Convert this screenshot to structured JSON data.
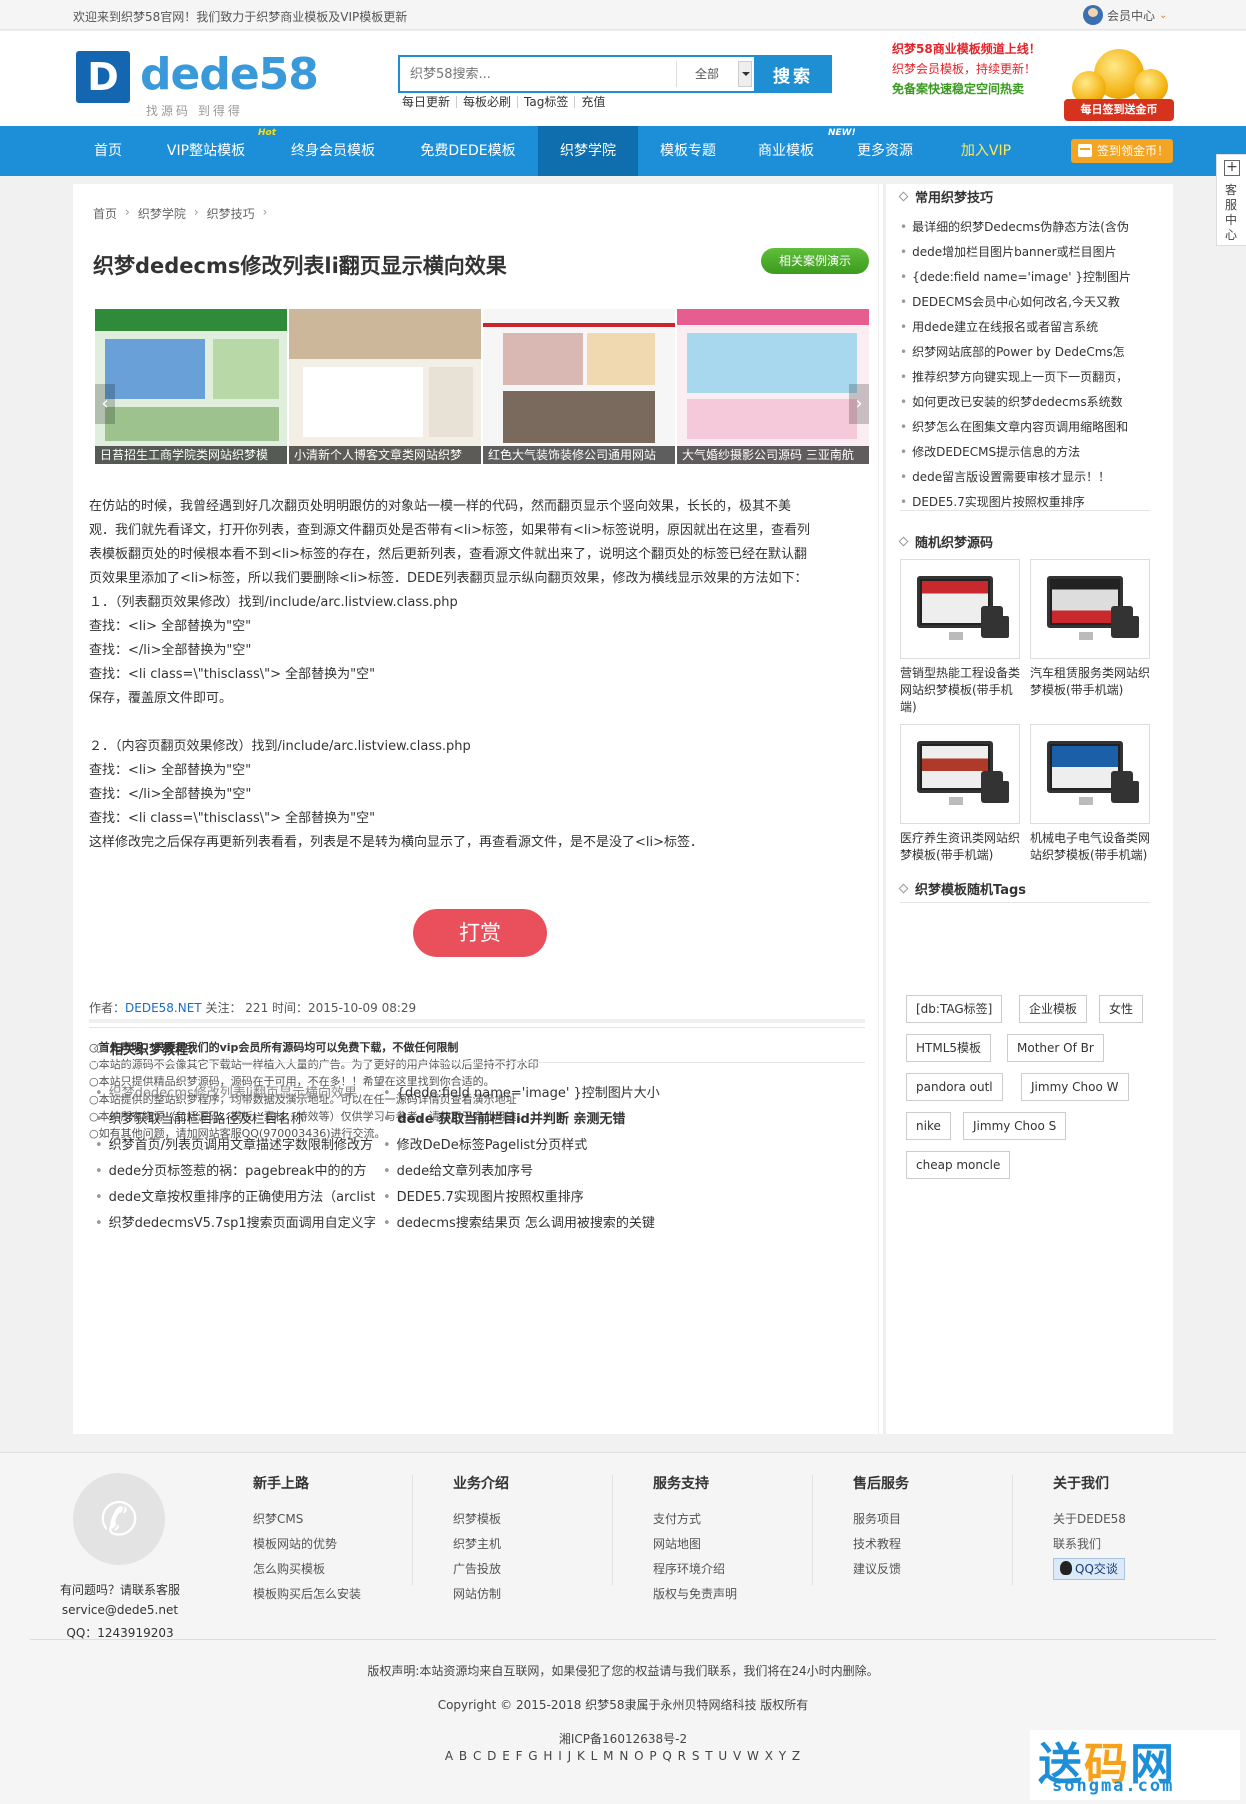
{
  "topbar": {
    "welcome": "欢迎来到织梦58官网！我们致力于织梦商业模板及VIP模板更新",
    "member_center": "会员中心"
  },
  "header": {
    "logo_text": "dede58",
    "logo_mark": "D",
    "logo_sub": "找源码 到得得",
    "search": {
      "placeholder": "织梦58搜索...",
      "scope": "全部",
      "button": "搜索"
    },
    "hotwords": [
      "每日更新",
      "每板必刷",
      "Tag标签",
      "充值"
    ],
    "promos": [
      {
        "text": "织梦58商业模板频道上线！",
        "color": "#e4242b"
      },
      {
        "text": "织梦会员模板，持续更新！",
        "color": "#e4242b"
      },
      {
        "text": "免备案快速稳定空间热卖",
        "color": "#3a9a1f"
      }
    ],
    "coin_ribbon": "每日签到送金币"
  },
  "nav": {
    "items": [
      "首页",
      "VIP整站模板",
      "终身会员模板",
      "免费DEDE模板",
      "织梦学院",
      "模板专题",
      "商业模板",
      "更多资源",
      "加入VIP"
    ],
    "badges": [
      "Hot",
      "NEW!"
    ],
    "signin": "签到领金币！"
  },
  "side_service": {
    "plus": "+",
    "label": "客服中心"
  },
  "breadcrumb": [
    "首页",
    "织梦学院",
    "织梦技巧"
  ],
  "article": {
    "title": "织梦dedecms修改列表li翻页显示横向效果",
    "demo_button": "相关案例演示",
    "slides": [
      "日苔招生工商学院类网站织梦模",
      "小清新个人博客文章类网站织梦",
      "红色大气装饰装修公司通用网站",
      "大气婚纱摄影公司源码 三亚南航"
    ],
    "paragraphs": [
      "在仿站的时候，我曾经遇到好几次翻页处明明跟仿的对象站一模一样的代码，然而翻页显示个竖向效果，长长的，极其不美",
      "观．我们就先看译文，打开你列表，查到源文件翻页处是否带有<li>标签，如果带有<li>标签说明，原因就出在这里，查看列",
      "表模板翻页处的时候根本看不到<li>标签的存在，然后更新列表，查看源文件就出来了，说明这个翻页处的标签已经在默认翻",
      "页效果里添加了<li>标签，所以我们要删除<li>标签．DEDE列表翻页显示纵向翻页效果，修改为横线显示效果的方法如下：",
      "１．（列表翻页效果修改）找到/include/arc.listview.class.php",
      "查找：<li> 全部替换为\"空\"",
      "查找：</li>全部替换为\"空\"",
      "查找：<li class=\\\"thisclass\\\"> 全部替换为\"空\"",
      "保存，覆盖原文件即可。",
      "",
      "２．（内容页翻页效果修改）找到/include/arc.listview.class.php",
      "查找：<li> 全部替换为\"空\"",
      "查找：</li>全部替换为\"空\"",
      "查找：<li class=\\\"thisclass\\\"> 全部替换为\"空\"",
      "这样修改完之后保存再更新列表看看，列表是不是转为横向显示了，再查看源文件，是不是没了<li>标签．"
    ],
    "tip_button": "打赏",
    "meta": {
      "author_label": "作者：",
      "author": "DEDE58.NET",
      "follow_label": " 关注：",
      "follow": "221",
      "time_label": " 时间：",
      "time": "2015-10-09 08:29"
    },
    "disclaimer": [
      "○首先声明，只要是我们的vip会员所有源码均可以免费下载，不做任何限制",
      "○本站的源码不会像其它下载站一样植入大量的广告。为了更好的用户体验以后坚持不打水印",
      "○本站只提供精品织梦源码，源码在于可用，不在多！！希望在这里找到你合适的。",
      "○本站提供的整站织梦程序，均带数据及演示地址。可以在任一源码详情页查看演示地址",
      "○本站所有资源（包括源码、模板、素材、特效等）仅供学习与参考，请勿用于商业用途。",
      "○如有其他问题，请加网站客服QQ(970003436)进行交流。"
    ],
    "related_title": "相关织梦教程：",
    "related": [
      {
        "text": "织梦dedecms修改列表li翻页显示横向效果",
        "style": "muted"
      },
      {
        "text": "{dede:field name='image' }控制图片大小",
        "style": ""
      },
      {
        "text": "织梦获取当前栏目路径及栏目名称",
        "style": ""
      },
      {
        "text": "dede 获取当前栏目id并判断 亲测无错",
        "style": "bold"
      },
      {
        "text": "织梦首页/列表页调用文章描述字数限制修改方",
        "style": ""
      },
      {
        "text": "修改DeDe标签Pagelist分页样式",
        "style": ""
      },
      {
        "text": "dede分页标签惹的祸：pagebreak中的的方",
        "style": ""
      },
      {
        "text": "dede给文章列表加序号",
        "style": ""
      },
      {
        "text": "dede文章按权重排序的正确使用方法（arclist",
        "style": ""
      },
      {
        "text": "DEDE5.7实现图片按照权重排序",
        "style": ""
      },
      {
        "text": "织梦dedecmsV5.7sp1搜索页面调用自定义字",
        "style": ""
      },
      {
        "text": "dedecms搜索结果页 怎么调用被搜索的关键",
        "style": ""
      }
    ]
  },
  "sidebar": {
    "tips_title": "常用织梦技巧",
    "tips": [
      "最详细的织梦Dedecms伪静态方法(含伪",
      "dede增加栏目图片banner或栏目图片",
      "{dede:field name='image' }控制图片",
      "DEDECMS会员中心如何改名,今天又教",
      "用dede建立在线报名或者留言系统",
      "织梦网站底部的Power by DedeCms怎",
      "推荐织梦方向键实现上一页下一页翻页，",
      "如何更改已安装的织梦dedecms系统数",
      "织梦怎么在图集文章内容页调用缩略图和",
      "修改DEDECMS提示信息的方法",
      "dede留言版设置需要审核才显示！！",
      "DEDE5.7实现图片按照权重排序"
    ],
    "random_title": "随机织梦源码",
    "random": [
      "营销型热能工程设备类网站织梦模板(带手机端)",
      "汽车租赁服务类网站织梦模板(带手机端)",
      "医疗养生资讯类网站织梦模板(带手机端)",
      "机械电子电气设备类网站织梦模板(带手机端)"
    ],
    "tags_title": "织梦模板随机Tags",
    "tags": [
      "[db:TAG标签]",
      "企业模板",
      "女性",
      "HTML5模板",
      "Mother Of Br",
      "pandora outl",
      "Jimmy Choo W",
      "nike",
      "Jimmy Choo S",
      "cheap moncle"
    ]
  },
  "footer": {
    "contact": {
      "question": "有问题吗？请联系客服",
      "email": "service@dede5.net",
      "qq": "QQ：1243919203"
    },
    "columns": [
      {
        "title": "新手上路",
        "links": [
          "织梦CMS",
          "模板网站的优势",
          "怎么购买模板",
          "模板购买后怎么安装"
        ]
      },
      {
        "title": "业务介绍",
        "links": [
          "织梦模板",
          "织梦主机",
          "广告投放",
          "网站仿制"
        ]
      },
      {
        "title": "服务支持",
        "links": [
          "支付方式",
          "网站地图",
          "程序环境介绍",
          "版权与免责声明"
        ]
      },
      {
        "title": "售后服务",
        "links": [
          "服务项目",
          "技术教程",
          "建议反馈"
        ]
      },
      {
        "title": "关于我们",
        "links": [
          "关于DEDE58",
          "联系我们"
        ]
      }
    ],
    "qq_button": "QQ交谈",
    "copyright_notice": "版权声明:本站资源均来自互联网，如果侵犯了您的权益请与我们联系，我们将在24小时内删除。",
    "copyright": "Copyright © 2015-2018 织梦58隶属于永州贝特网络科技 版权所有",
    "icp": "湘ICP备16012638号-2",
    "letters": "A B C D E F G H I J K L M N O P Q R S T U V W X Y Z"
  },
  "watermark": {
    "big_a": "送",
    "big_b": "码",
    "big_c": "网",
    "small": "songma.com"
  }
}
